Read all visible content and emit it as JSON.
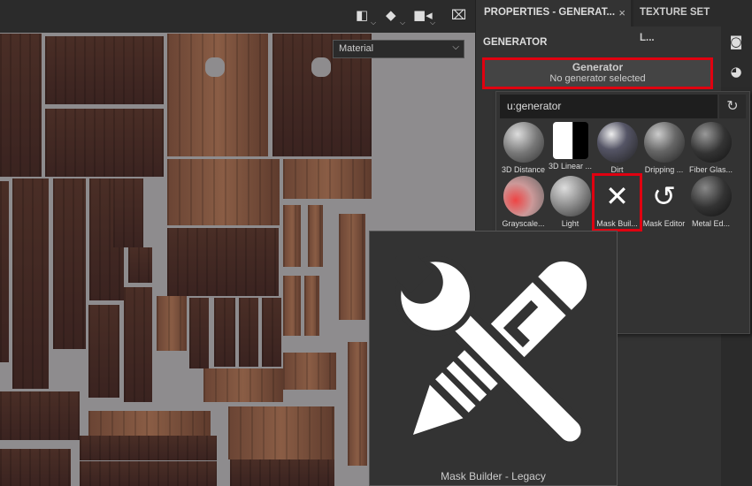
{
  "toolbar": {
    "icons": [
      "split-view-icon",
      "cube-icon",
      "camera-video-icon",
      "screenshot-camera-icon"
    ]
  },
  "viewport": {
    "channel_dropdown": "Material"
  },
  "panel": {
    "tabs": [
      {
        "label": "PROPERTIES - GENERAT...",
        "close": "×"
      },
      {
        "label": "TEXTURE SET L..."
      }
    ],
    "section": "GENERATOR",
    "generator": {
      "title": "Generator",
      "status": "No generator selected"
    },
    "highlight_color": "#e00010"
  },
  "popup": {
    "search_value": "u:generator",
    "items": [
      {
        "label": "3D Distance"
      },
      {
        "label": "3D Linear ..."
      },
      {
        "label": "Dirt"
      },
      {
        "label": "Dripping ..."
      },
      {
        "label": "Fiber Glas..."
      },
      {
        "label": "Grayscale..."
      },
      {
        "label": "Light"
      },
      {
        "label": "Mask Buil..."
      },
      {
        "label": "Mask Editor"
      },
      {
        "label": "Metal Ed..."
      }
    ]
  },
  "tooltip": {
    "caption": "Mask Builder - Legacy",
    "icon": "wrench-pencil-icon"
  }
}
